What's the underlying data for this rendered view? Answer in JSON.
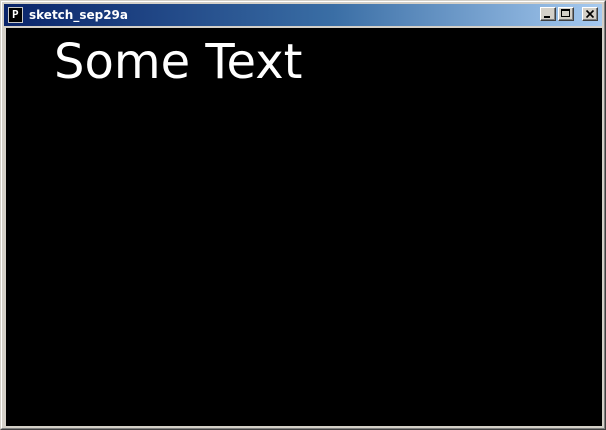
{
  "window": {
    "title": "sketch_sep29a",
    "icon": "processing-p-icon",
    "icon_glyph": "P",
    "buttons": {
      "minimize": "minimize-icon",
      "maximize": "maximize-icon",
      "close": "close-icon"
    }
  },
  "canvas": {
    "text": "Some Text",
    "background_color": "#000000",
    "text_color": "#ffffff"
  },
  "colors": {
    "titlebar_start": "#0a246a",
    "titlebar_end": "#a6caf0",
    "chrome": "#d4d0c8"
  }
}
